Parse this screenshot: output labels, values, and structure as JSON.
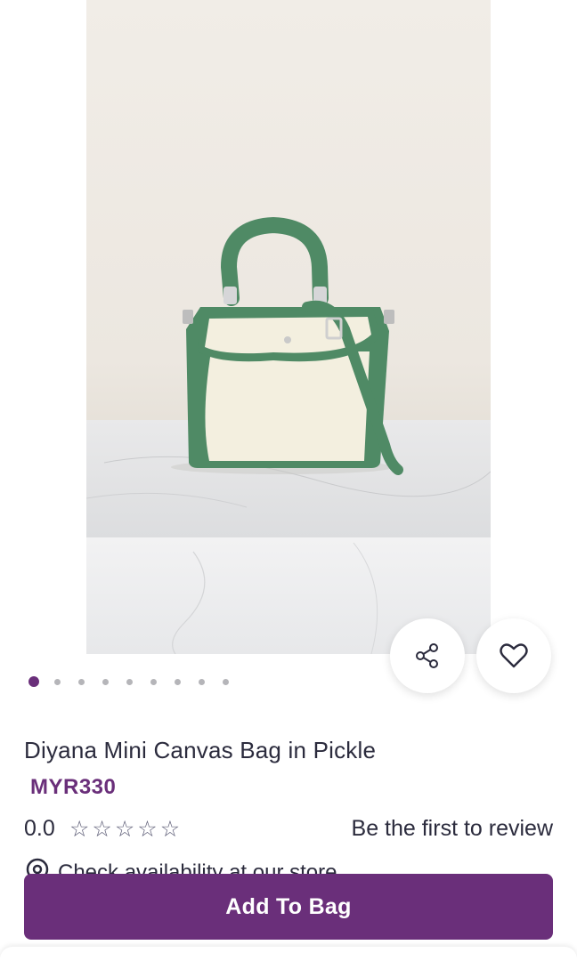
{
  "product": {
    "title": "Diyana Mini Canvas Bag in Pickle",
    "price": "MYR330",
    "rating_value": "0.0",
    "stars_filled": 0,
    "stars_total": 5,
    "review_prompt": "Be the first to review",
    "store_check": "Check availability at our store"
  },
  "gallery": {
    "image_count": 9,
    "active_index": 0
  },
  "actions": {
    "share_icon": "share-icon",
    "wishlist_icon": "heart-icon",
    "add_to_bag": "Add To Bag"
  },
  "colors": {
    "accent": "#6a2f7a",
    "bag_green": "#4f8a65",
    "bag_cream": "#f3efdf"
  }
}
